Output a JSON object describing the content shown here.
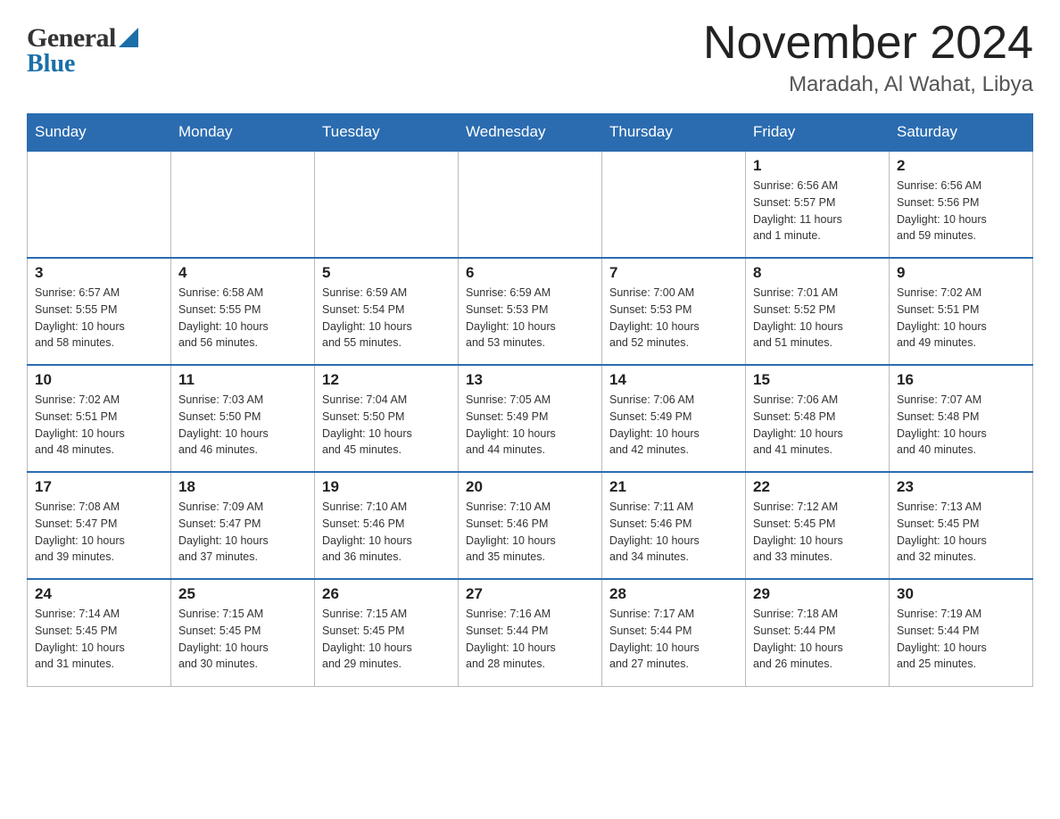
{
  "header": {
    "logo_general": "General",
    "logo_blue": "Blue",
    "month_title": "November 2024",
    "location": "Maradah, Al Wahat, Libya"
  },
  "days_of_week": [
    "Sunday",
    "Monday",
    "Tuesday",
    "Wednesday",
    "Thursday",
    "Friday",
    "Saturday"
  ],
  "weeks": [
    {
      "days": [
        {
          "num": "",
          "info": "",
          "empty": true
        },
        {
          "num": "",
          "info": "",
          "empty": true
        },
        {
          "num": "",
          "info": "",
          "empty": true
        },
        {
          "num": "",
          "info": "",
          "empty": true
        },
        {
          "num": "",
          "info": "",
          "empty": true
        },
        {
          "num": "1",
          "info": "Sunrise: 6:56 AM\nSunset: 5:57 PM\nDaylight: 11 hours\nand 1 minute."
        },
        {
          "num": "2",
          "info": "Sunrise: 6:56 AM\nSunset: 5:56 PM\nDaylight: 10 hours\nand 59 minutes."
        }
      ]
    },
    {
      "days": [
        {
          "num": "3",
          "info": "Sunrise: 6:57 AM\nSunset: 5:55 PM\nDaylight: 10 hours\nand 58 minutes."
        },
        {
          "num": "4",
          "info": "Sunrise: 6:58 AM\nSunset: 5:55 PM\nDaylight: 10 hours\nand 56 minutes."
        },
        {
          "num": "5",
          "info": "Sunrise: 6:59 AM\nSunset: 5:54 PM\nDaylight: 10 hours\nand 55 minutes."
        },
        {
          "num": "6",
          "info": "Sunrise: 6:59 AM\nSunset: 5:53 PM\nDaylight: 10 hours\nand 53 minutes."
        },
        {
          "num": "7",
          "info": "Sunrise: 7:00 AM\nSunset: 5:53 PM\nDaylight: 10 hours\nand 52 minutes."
        },
        {
          "num": "8",
          "info": "Sunrise: 7:01 AM\nSunset: 5:52 PM\nDaylight: 10 hours\nand 51 minutes."
        },
        {
          "num": "9",
          "info": "Sunrise: 7:02 AM\nSunset: 5:51 PM\nDaylight: 10 hours\nand 49 minutes."
        }
      ]
    },
    {
      "days": [
        {
          "num": "10",
          "info": "Sunrise: 7:02 AM\nSunset: 5:51 PM\nDaylight: 10 hours\nand 48 minutes."
        },
        {
          "num": "11",
          "info": "Sunrise: 7:03 AM\nSunset: 5:50 PM\nDaylight: 10 hours\nand 46 minutes."
        },
        {
          "num": "12",
          "info": "Sunrise: 7:04 AM\nSunset: 5:50 PM\nDaylight: 10 hours\nand 45 minutes."
        },
        {
          "num": "13",
          "info": "Sunrise: 7:05 AM\nSunset: 5:49 PM\nDaylight: 10 hours\nand 44 minutes."
        },
        {
          "num": "14",
          "info": "Sunrise: 7:06 AM\nSunset: 5:49 PM\nDaylight: 10 hours\nand 42 minutes."
        },
        {
          "num": "15",
          "info": "Sunrise: 7:06 AM\nSunset: 5:48 PM\nDaylight: 10 hours\nand 41 minutes."
        },
        {
          "num": "16",
          "info": "Sunrise: 7:07 AM\nSunset: 5:48 PM\nDaylight: 10 hours\nand 40 minutes."
        }
      ]
    },
    {
      "days": [
        {
          "num": "17",
          "info": "Sunrise: 7:08 AM\nSunset: 5:47 PM\nDaylight: 10 hours\nand 39 minutes."
        },
        {
          "num": "18",
          "info": "Sunrise: 7:09 AM\nSunset: 5:47 PM\nDaylight: 10 hours\nand 37 minutes."
        },
        {
          "num": "19",
          "info": "Sunrise: 7:10 AM\nSunset: 5:46 PM\nDaylight: 10 hours\nand 36 minutes."
        },
        {
          "num": "20",
          "info": "Sunrise: 7:10 AM\nSunset: 5:46 PM\nDaylight: 10 hours\nand 35 minutes."
        },
        {
          "num": "21",
          "info": "Sunrise: 7:11 AM\nSunset: 5:46 PM\nDaylight: 10 hours\nand 34 minutes."
        },
        {
          "num": "22",
          "info": "Sunrise: 7:12 AM\nSunset: 5:45 PM\nDaylight: 10 hours\nand 33 minutes."
        },
        {
          "num": "23",
          "info": "Sunrise: 7:13 AM\nSunset: 5:45 PM\nDaylight: 10 hours\nand 32 minutes."
        }
      ]
    },
    {
      "days": [
        {
          "num": "24",
          "info": "Sunrise: 7:14 AM\nSunset: 5:45 PM\nDaylight: 10 hours\nand 31 minutes."
        },
        {
          "num": "25",
          "info": "Sunrise: 7:15 AM\nSunset: 5:45 PM\nDaylight: 10 hours\nand 30 minutes."
        },
        {
          "num": "26",
          "info": "Sunrise: 7:15 AM\nSunset: 5:45 PM\nDaylight: 10 hours\nand 29 minutes."
        },
        {
          "num": "27",
          "info": "Sunrise: 7:16 AM\nSunset: 5:44 PM\nDaylight: 10 hours\nand 28 minutes."
        },
        {
          "num": "28",
          "info": "Sunrise: 7:17 AM\nSunset: 5:44 PM\nDaylight: 10 hours\nand 27 minutes."
        },
        {
          "num": "29",
          "info": "Sunrise: 7:18 AM\nSunset: 5:44 PM\nDaylight: 10 hours\nand 26 minutes."
        },
        {
          "num": "30",
          "info": "Sunrise: 7:19 AM\nSunset: 5:44 PM\nDaylight: 10 hours\nand 25 minutes."
        }
      ]
    }
  ]
}
